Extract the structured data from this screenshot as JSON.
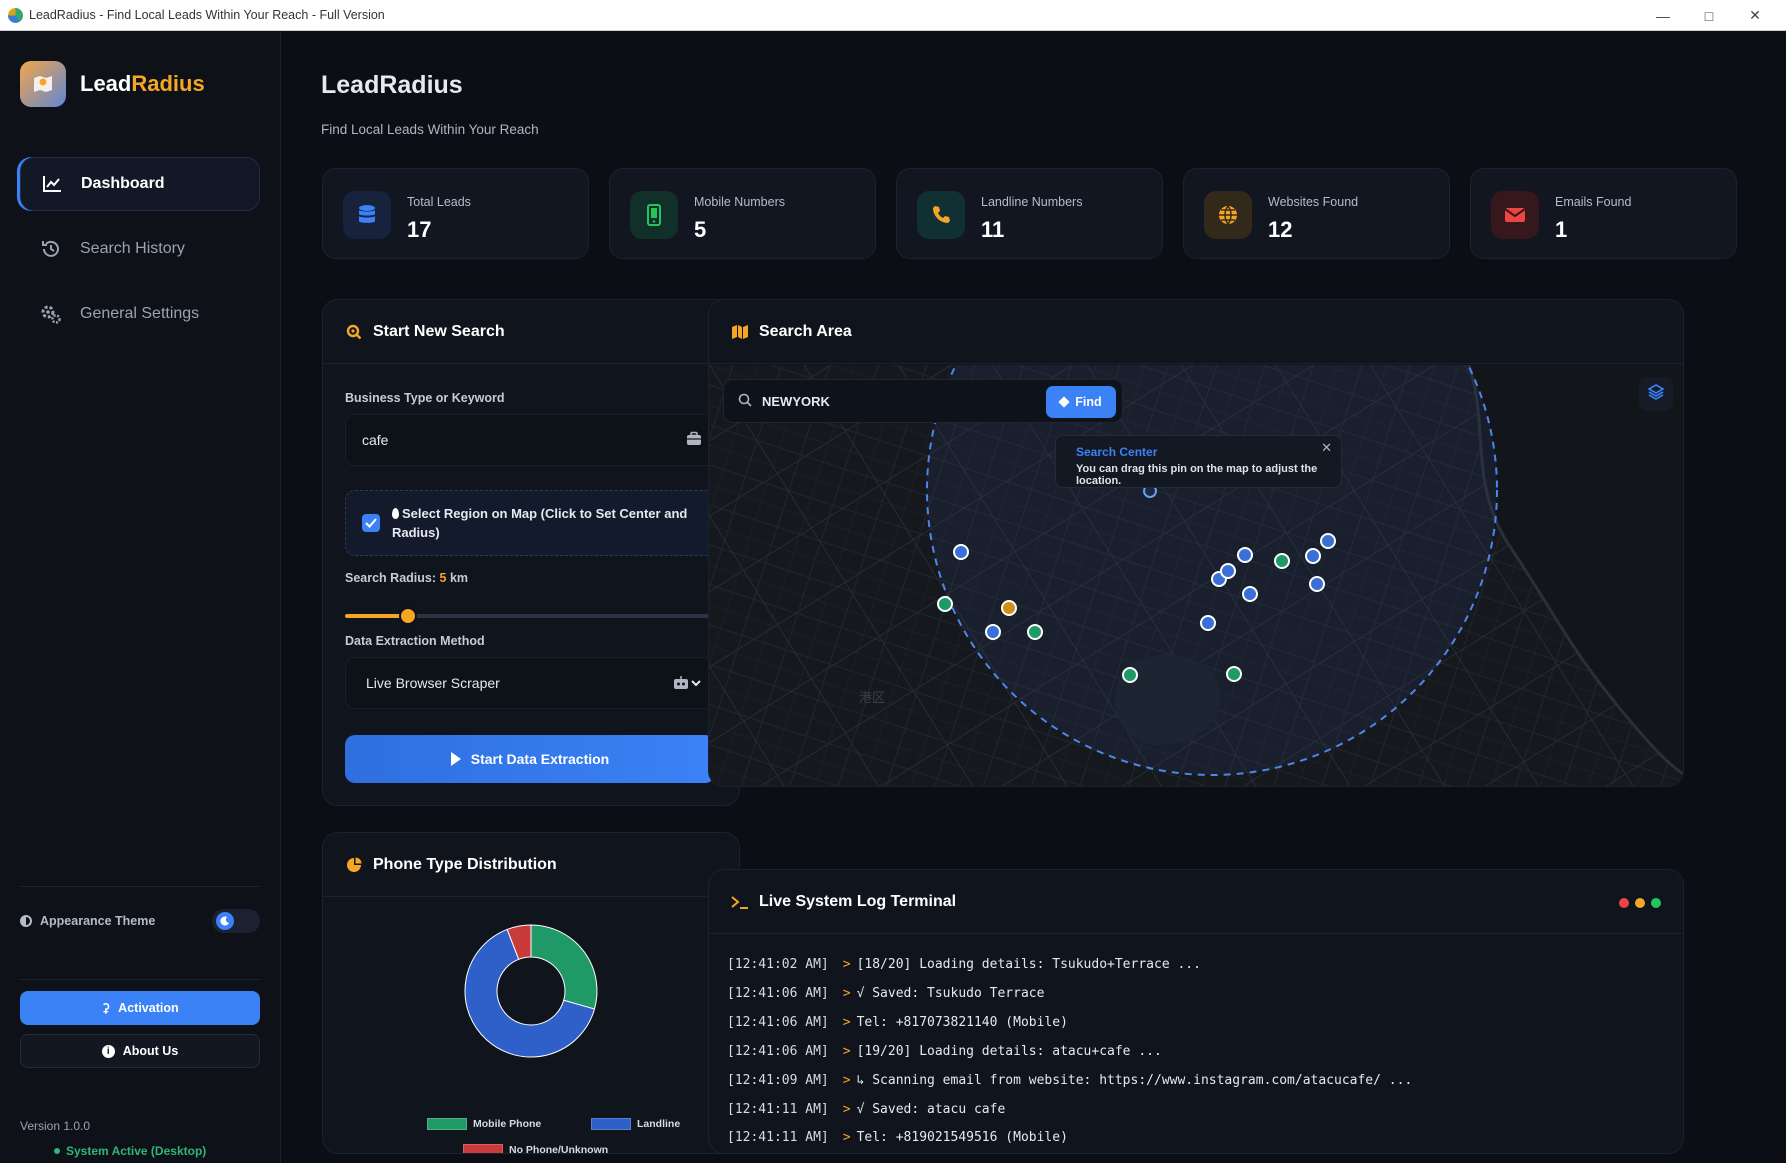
{
  "window": {
    "title": "LeadRadius - Find Local Leads Within Your Reach - Full Version"
  },
  "sidebar": {
    "brand": {
      "name_a": "Lead",
      "name_b": "Radius"
    },
    "nav": [
      {
        "label": "Dashboard",
        "icon": "chart-line-icon"
      },
      {
        "label": "Search History",
        "icon": "history-icon"
      },
      {
        "label": "General Settings",
        "icon": "gears-icon"
      }
    ],
    "theme_label": "Appearance Theme",
    "activation_label": "Activation",
    "about_label": "About Us",
    "version": "Version 1.0.0",
    "status": "System Active (Desktop)"
  },
  "header": {
    "title": "LeadRadius",
    "subtitle": "Find Local Leads Within Your Reach"
  },
  "stats": [
    {
      "label": "Total Leads",
      "value": "17",
      "icon": "database-icon",
      "color": "#3b82f6"
    },
    {
      "label": "Mobile Numbers",
      "value": "5",
      "icon": "mobile-icon",
      "color": "#22c55e"
    },
    {
      "label": "Landline Numbers",
      "value": "11",
      "icon": "phone-icon",
      "color": "#f5a623"
    },
    {
      "label": "Websites Found",
      "value": "12",
      "icon": "globe-icon",
      "color": "#f5a623"
    },
    {
      "label": "Emails Found",
      "value": "1",
      "icon": "envelope-icon",
      "color": "#ef4444"
    }
  ],
  "search": {
    "title": "Start New Search",
    "keyword_label": "Business Type or Keyword",
    "keyword_value": "cafe",
    "region_label": "Select Region on Map (Click to Set Center and Radius)",
    "region_checked": true,
    "radius_label": "Search Radius:",
    "radius_value": "5",
    "radius_unit": "km",
    "radius_fraction": 0.17,
    "method_label": "Data Extraction Method",
    "method_value": "Live Browser Scraper",
    "start_label": "Start Data Extraction"
  },
  "map": {
    "title": "Search Area",
    "search_value": "NEWYORK",
    "find_label": "Find",
    "popup_title": "Search Center",
    "popup_desc": "You can drag this pin on the map to adjust the location.",
    "watermark": "港区"
  },
  "phone_dist": {
    "title": "Phone Type Distribution",
    "legend": [
      "Mobile Phone",
      "Landline",
      "No Phone/Unknown"
    ]
  },
  "chart_data": {
    "type": "pie",
    "donut": true,
    "categories": [
      "Mobile Phone",
      "Landline",
      "No Phone/Unknown"
    ],
    "values": [
      5,
      11,
      1
    ],
    "colors": [
      "#1f9a66",
      "#2f5fc9",
      "#c93a3a"
    ]
  },
  "terminal": {
    "title": "Live System Log Terminal",
    "lines": [
      {
        "ts": "[12:41:02 AM]",
        "msg": "[18/20] Loading details: Tsukudo+Terrace ..."
      },
      {
        "ts": "[12:41:06 AM]",
        "msg": "√ Saved: Tsukudo Terrace"
      },
      {
        "ts": "[12:41:06 AM]",
        "msg": "Tel: +817073821140 (Mobile)"
      },
      {
        "ts": "[12:41:06 AM]",
        "msg": "[19/20] Loading details: atacu+cafe ..."
      },
      {
        "ts": "[12:41:09 AM]",
        "msg": "↳ Scanning email from website: https://www.instagram.com/atacucafe/ ..."
      },
      {
        "ts": "[12:41:11 AM]",
        "msg": "√ Saved: atacu cafe"
      },
      {
        "ts": "[12:41:11 AM]",
        "msg": "Tel: +819021549516 (Mobile)"
      }
    ]
  }
}
